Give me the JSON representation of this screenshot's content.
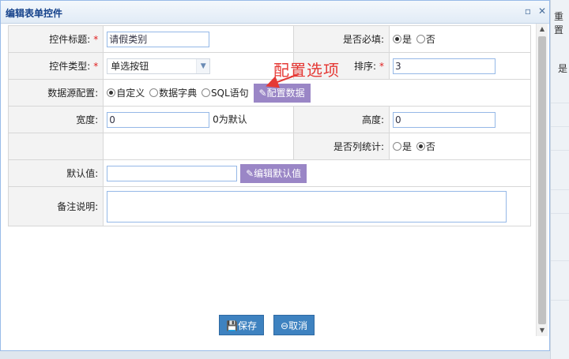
{
  "dialog": {
    "title": "编辑表单控件"
  },
  "form": {
    "title_label": "控件标题:",
    "title_value": "请假类别",
    "required_label": "是否必填:",
    "required_yes": "是",
    "required_no": "否",
    "type_label": "控件类型:",
    "type_value": "单选按钮",
    "order_label": "排序:",
    "order_value": "3",
    "source_label": "数据源配置:",
    "source_custom": "自定义",
    "source_dict": "数据字典",
    "source_sql": "SQL语句",
    "config_data_button": "配置数据",
    "width_label": "宽度:",
    "width_value": "0",
    "width_hint": "0为默认",
    "height_label": "高度:",
    "height_value": "0",
    "stat_label": "是否列统计:",
    "stat_yes": "是",
    "stat_no": "否",
    "default_label": "默认值:",
    "default_value": "",
    "edit_default_button": "编辑默认值",
    "remark_label": "备注说明:",
    "remark_value": "",
    "required_mark": "*"
  },
  "annotation": "配置选项",
  "footer": {
    "save_label": "保存",
    "cancel_label": "取消"
  },
  "background": {
    "frag_top": "重 置",
    "frag_mid": "是"
  },
  "colors": {
    "accent_blue": "#3e82c0",
    "purple_button": "#9a86c6",
    "annotation_red": "#e53935"
  }
}
